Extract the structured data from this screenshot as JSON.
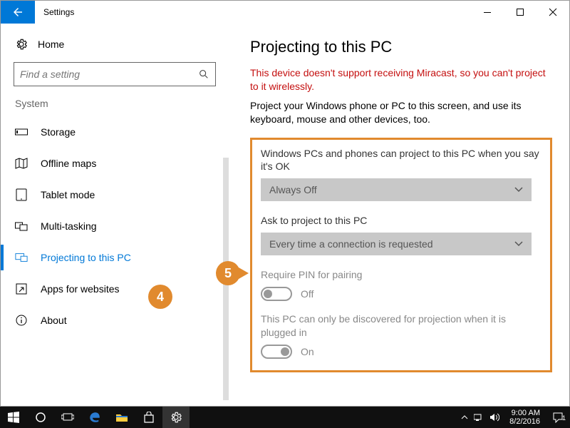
{
  "window": {
    "title": "Settings"
  },
  "sidebar": {
    "home": "Home",
    "search_placeholder": "Find a setting",
    "section": "System",
    "items": [
      {
        "label": "Storage"
      },
      {
        "label": "Offline maps"
      },
      {
        "label": "Tablet mode"
      },
      {
        "label": "Multi-tasking"
      },
      {
        "label": "Projecting to this PC"
      },
      {
        "label": "Apps for websites"
      },
      {
        "label": "About"
      }
    ]
  },
  "content": {
    "title": "Projecting to this PC",
    "error": "This device doesn't support receiving Miracast, so you can't project to it wirelessly.",
    "description": "Project your Windows phone or PC to this screen, and use its keyboard, mouse and other devices, too.",
    "opt1_label": "Windows PCs and phones can project to this PC when you say it's OK",
    "opt1_value": "Always Off",
    "opt2_label": "Ask to project to this PC",
    "opt2_value": "Every time a connection is requested",
    "opt3_label": "Require PIN for pairing",
    "opt3_value": "Off",
    "opt4_label": "This PC can only be discovered for projection when it is plugged in",
    "opt4_value": "On"
  },
  "callouts": {
    "b4": "4",
    "b5": "5"
  },
  "taskbar": {
    "time": "9:00 AM",
    "date": "8/2/2016",
    "notif_count": "1"
  }
}
